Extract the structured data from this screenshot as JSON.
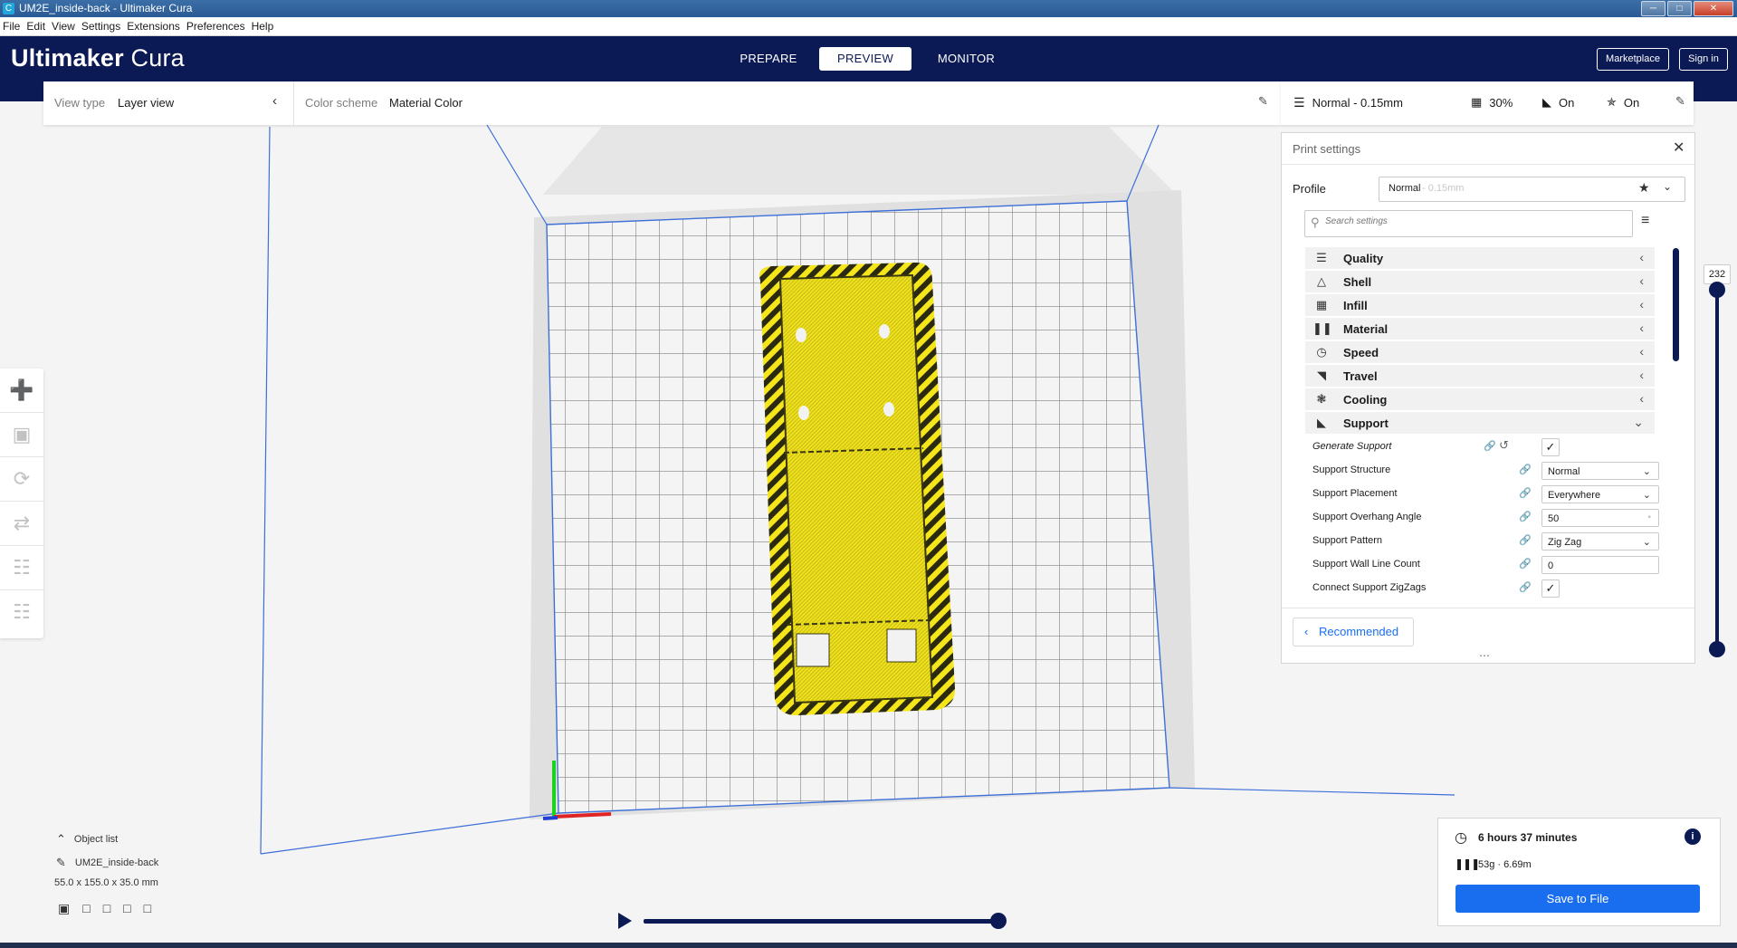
{
  "window": {
    "title": "UM2E_inside-back - Ultimaker Cura",
    "app_icon": "C"
  },
  "menu": [
    "File",
    "Edit",
    "View",
    "Settings",
    "Extensions",
    "Preferences",
    "Help"
  ],
  "header": {
    "logo_bold": "Ultimaker",
    "logo_light": " Cura",
    "stages": [
      "PREPARE",
      "PREVIEW",
      "MONITOR"
    ],
    "active_stage": "PREVIEW",
    "marketplace_label": "Marketplace",
    "signin_label": "Sign in"
  },
  "viewbar": {
    "view_type_label": "View type",
    "view_type_value": "Layer view",
    "color_scheme_label": "Color scheme",
    "color_scheme_value": "Material Color"
  },
  "print_header": {
    "profile": "Normal - 0.15mm",
    "infill": "30%",
    "support": "On",
    "adhesion": "On"
  },
  "print_settings": {
    "title": "Print settings",
    "profile_label": "Profile",
    "profile_name": "Normal",
    "profile_layer": " - 0.15mm",
    "search_placeholder": "Search settings",
    "sections": [
      {
        "name": "Quality",
        "icon": "quality-icon"
      },
      {
        "name": "Shell",
        "icon": "shell-icon"
      },
      {
        "name": "Infill",
        "icon": "infill-icon"
      },
      {
        "name": "Material",
        "icon": "material-icon"
      },
      {
        "name": "Speed",
        "icon": "speed-icon"
      },
      {
        "name": "Travel",
        "icon": "travel-icon"
      },
      {
        "name": "Cooling",
        "icon": "cooling-icon"
      },
      {
        "name": "Support",
        "icon": "support-icon"
      }
    ],
    "support_settings": {
      "generate_support": "Generate Support",
      "support_structure": "Support Structure",
      "support_structure_value": "Normal",
      "support_placement": "Support Placement",
      "support_placement_value": "Everywhere",
      "overhang_angle": "Support Overhang Angle",
      "overhang_angle_value": "50",
      "overhang_unit": "°",
      "support_pattern": "Support Pattern",
      "support_pattern_value": "Zig Zag",
      "wall_line_count": "Support Wall Line Count",
      "wall_line_count_value": "0",
      "connect_zigzags": "Connect Support ZigZags"
    },
    "recommended_label": "Recommended"
  },
  "layer_slider": {
    "value": "232"
  },
  "object_list": {
    "label": "Object list",
    "object_name": "UM2E_inside-back",
    "dimensions": "55.0 x 155.0 x 35.0 mm"
  },
  "print_info": {
    "time": "6 hours 37 minutes",
    "material": "53g · 6.69m",
    "save_label": "Save to File"
  },
  "colors": {
    "header": "#0b1a55",
    "accent": "#196ef0",
    "layer": "#f4e61a"
  }
}
